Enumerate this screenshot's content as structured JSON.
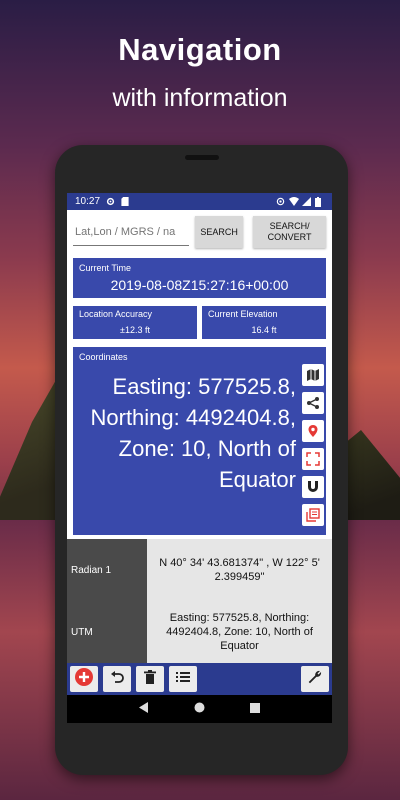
{
  "promo": {
    "title": "Navigation",
    "subtitle": "with information"
  },
  "status_bar": {
    "time": "10:27",
    "icons": [
      "gear-icon",
      "sd-card-icon",
      "location-icon",
      "wifi-icon",
      "signal-icon",
      "battery-icon"
    ]
  },
  "search": {
    "placeholder": "Lat,Lon / MGRS / na",
    "search_label": "SEARCH",
    "search_convert_label": "SEARCH/ CONVERT"
  },
  "current_time": {
    "label": "Current Time",
    "value": "2019-08-08Z15:27:16+00:00"
  },
  "location_accuracy": {
    "label": "Location Accuracy",
    "value": "±12.3 ft"
  },
  "current_elevation": {
    "label": "Current Elevation",
    "value": "16.4 ft"
  },
  "coordinates": {
    "label": "Coordinates",
    "value": "Easting: 577525.8, Northing: 4492404.8, Zone: 10, North of Equator",
    "tools": [
      "map-icon",
      "share-icon",
      "map-pin-icon",
      "fullscreen-icon",
      "magnet-icon",
      "copy-icon"
    ]
  },
  "results": [
    {
      "key": "Radian 1",
      "value": "N 40° 34' 43.681374\" , W 122° 5' 2.399459\""
    },
    {
      "key": "UTM",
      "value": "Easting: 577525.8, Northing: 4492404.8, Zone: 10, North of Equator"
    }
  ],
  "bottom_bar": {
    "buttons": [
      "add-icon",
      "undo-icon",
      "delete-icon",
      "list-icon",
      "wrench-icon"
    ]
  },
  "colors": {
    "primary": "#3949ab",
    "toolbar": "#2b3b8f",
    "add_red": "#e53935"
  }
}
